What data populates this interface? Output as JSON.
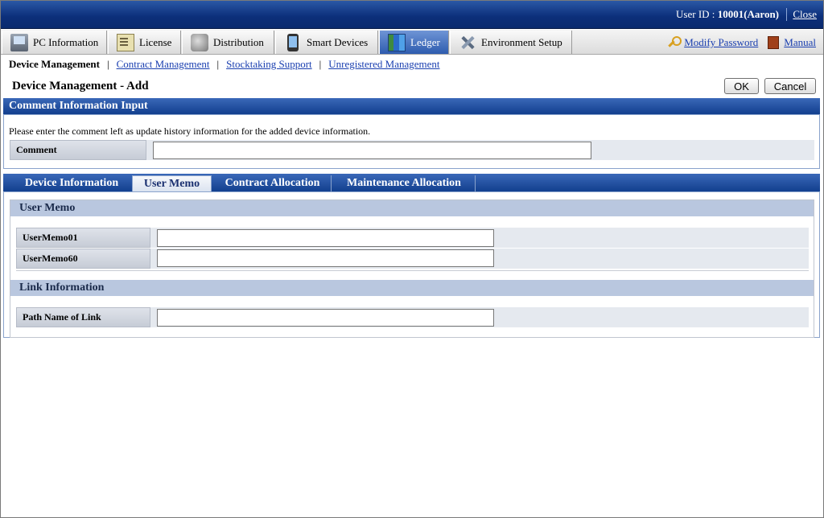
{
  "header": {
    "user_label": "User ID : ",
    "user_value": "10001(Aaron)",
    "close_label": "Close"
  },
  "main_tabs": [
    {
      "label": "PC Information",
      "icon": "pc-icon"
    },
    {
      "label": "License",
      "icon": "license-icon"
    },
    {
      "label": "Distribution",
      "icon": "distribution-icon"
    },
    {
      "label": "Smart Devices",
      "icon": "smart-device-icon"
    },
    {
      "label": "Ledger",
      "icon": "ledger-icon",
      "active": true
    },
    {
      "label": "Environment Setup",
      "icon": "tools-icon"
    }
  ],
  "right_links": {
    "modify_password": "Modify Password",
    "manual": "Manual"
  },
  "subnav": {
    "current": "Device Management",
    "links": [
      "Contract Management",
      "Stocktaking Support",
      "Unregistered Management"
    ]
  },
  "page": {
    "title": "Device Management - Add",
    "ok_label": "OK",
    "cancel_label": "Cancel"
  },
  "comment_section": {
    "title": "Comment Information Input",
    "description": "Please enter the comment left as update history information for the added device information.",
    "comment_label": "Comment",
    "comment_value": ""
  },
  "detail_tabs": [
    {
      "label": "Device Information"
    },
    {
      "label": "User Memo",
      "active": true
    },
    {
      "label": "Contract Allocation"
    },
    {
      "label": "Maintenance Allocation"
    }
  ],
  "user_memo": {
    "title": "User Memo",
    "fields": [
      {
        "label": "UserMemo01",
        "value": ""
      },
      {
        "label": "UserMemo60",
        "value": ""
      }
    ]
  },
  "link_information": {
    "title": "Link Information",
    "path_label": "Path Name of Link",
    "path_value": ""
  },
  "colors": {
    "title_bar": "#0c2f7a",
    "section_bar": "#123f8e",
    "link": "#1a3fb0",
    "subhead_bg": "#b9c7df"
  }
}
